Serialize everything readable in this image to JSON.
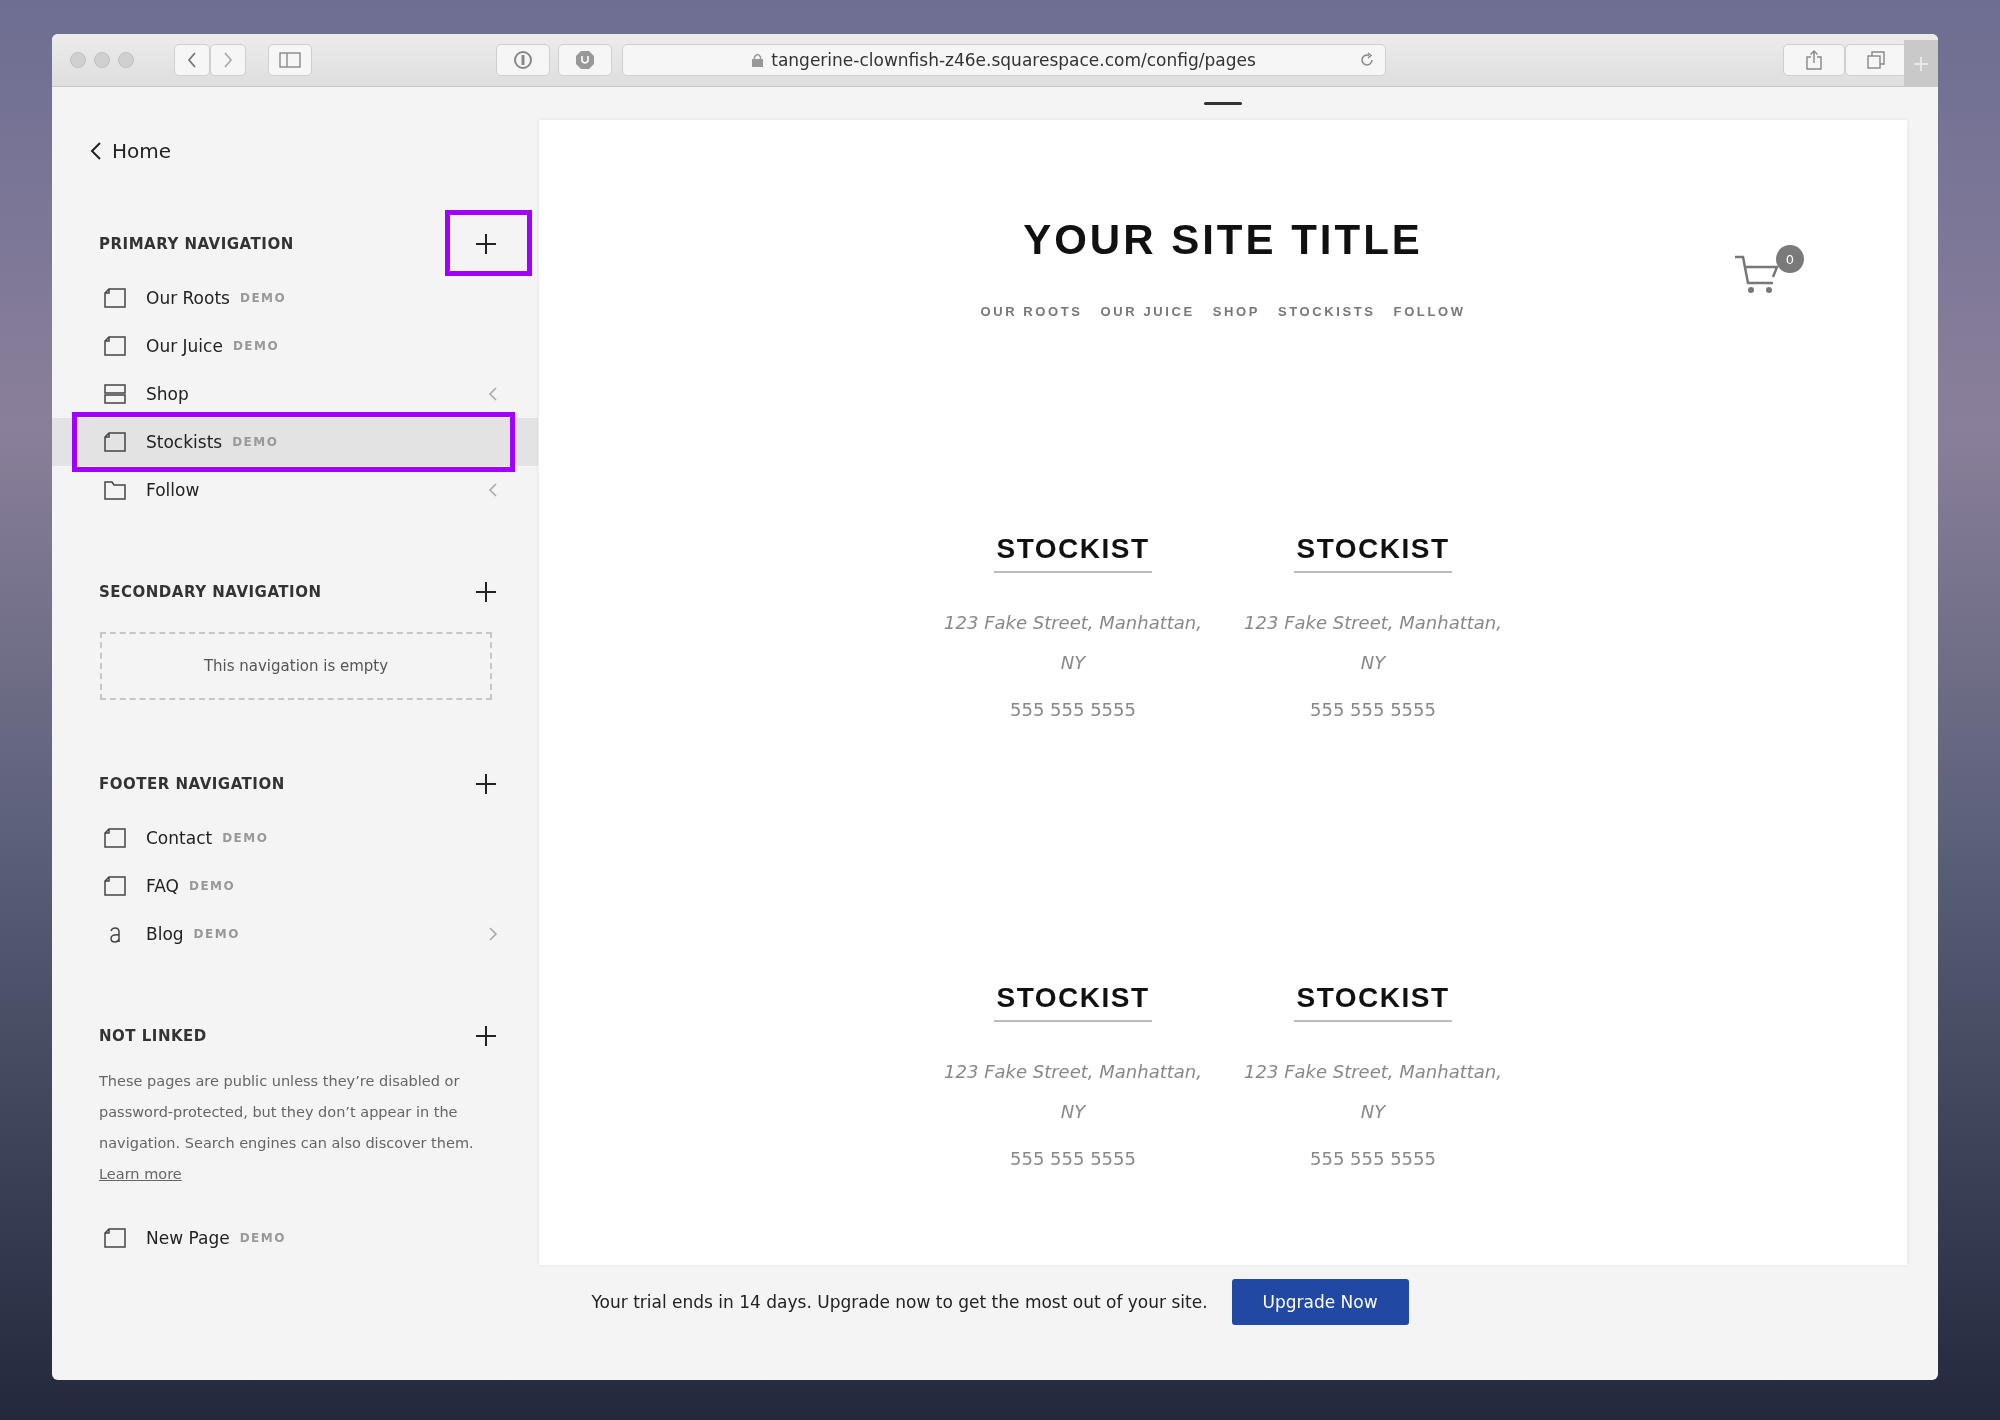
{
  "browser": {
    "url": "tangerine-clownfish-z46e.squarespace.com/config/pages"
  },
  "sidebar": {
    "back_link": "Home",
    "sections": [
      {
        "kind": "list",
        "title": "PRIMARY NAVIGATION",
        "add_highlighted": true,
        "items": [
          {
            "kind": "page",
            "label": "Our Roots",
            "badge": "DEMO",
            "selected": false
          },
          {
            "kind": "page",
            "label": "Our Juice",
            "badge": "DEMO",
            "selected": false
          },
          {
            "kind": "index",
            "label": "Shop",
            "chevron_left": true,
            "selected": false
          },
          {
            "kind": "page",
            "label": "Stockists",
            "badge": "DEMO",
            "selected": true,
            "highlighted": true
          },
          {
            "kind": "folder",
            "label": "Follow",
            "chevron_left": true,
            "selected": false
          }
        ]
      },
      {
        "kind": "empty",
        "title": "SECONDARY NAVIGATION",
        "empty_text": "This navigation is empty"
      },
      {
        "kind": "list",
        "title": "FOOTER NAVIGATION",
        "items": [
          {
            "kind": "page",
            "label": "Contact",
            "badge": "DEMO",
            "selected": false
          },
          {
            "kind": "page",
            "label": "FAQ",
            "badge": "DEMO",
            "selected": false
          },
          {
            "kind": "blog",
            "label": "Blog",
            "badge": "DEMO",
            "chevron_right": true,
            "selected": false
          }
        ]
      },
      {
        "kind": "list",
        "title": "NOT LINKED",
        "description": "These pages are public unless they’re disabled or password-protected, but they don’t appear in the navigation. Search engines can also discover them.",
        "learn_more": "Learn more",
        "items": [
          {
            "kind": "page",
            "label": "New Page",
            "badge": "DEMO",
            "selected": false
          }
        ]
      }
    ]
  },
  "preview": {
    "site_title": "YOUR SITE TITLE",
    "nav": [
      "OUR ROOTS",
      "OUR JUICE",
      "SHOP",
      "STOCKISTS",
      "FOLLOW"
    ],
    "cart_count": "0",
    "stockists": [
      {
        "name": "STOCKIST",
        "address_lines": [
          "123 Fake Street, Manhattan,",
          "NY"
        ],
        "phone": "555 555 5555"
      },
      {
        "name": "STOCKIST",
        "address_lines": [
          "123 Fake Street, Manhattan,",
          "NY"
        ],
        "phone": "555 555 5555"
      },
      {
        "name": "STOCKIST",
        "address_lines": [
          "123 Fake Street, Manhattan,",
          "NY"
        ],
        "phone": "555 555 5555"
      },
      {
        "name": "STOCKIST",
        "address_lines": [
          "123 Fake Street, Manhattan,",
          "NY"
        ],
        "phone": "555 555 5555"
      }
    ]
  },
  "trial_bar": {
    "message": "Your trial ends in 14 days. Upgrade now to get the most out of your site.",
    "button": "Upgrade Now"
  }
}
